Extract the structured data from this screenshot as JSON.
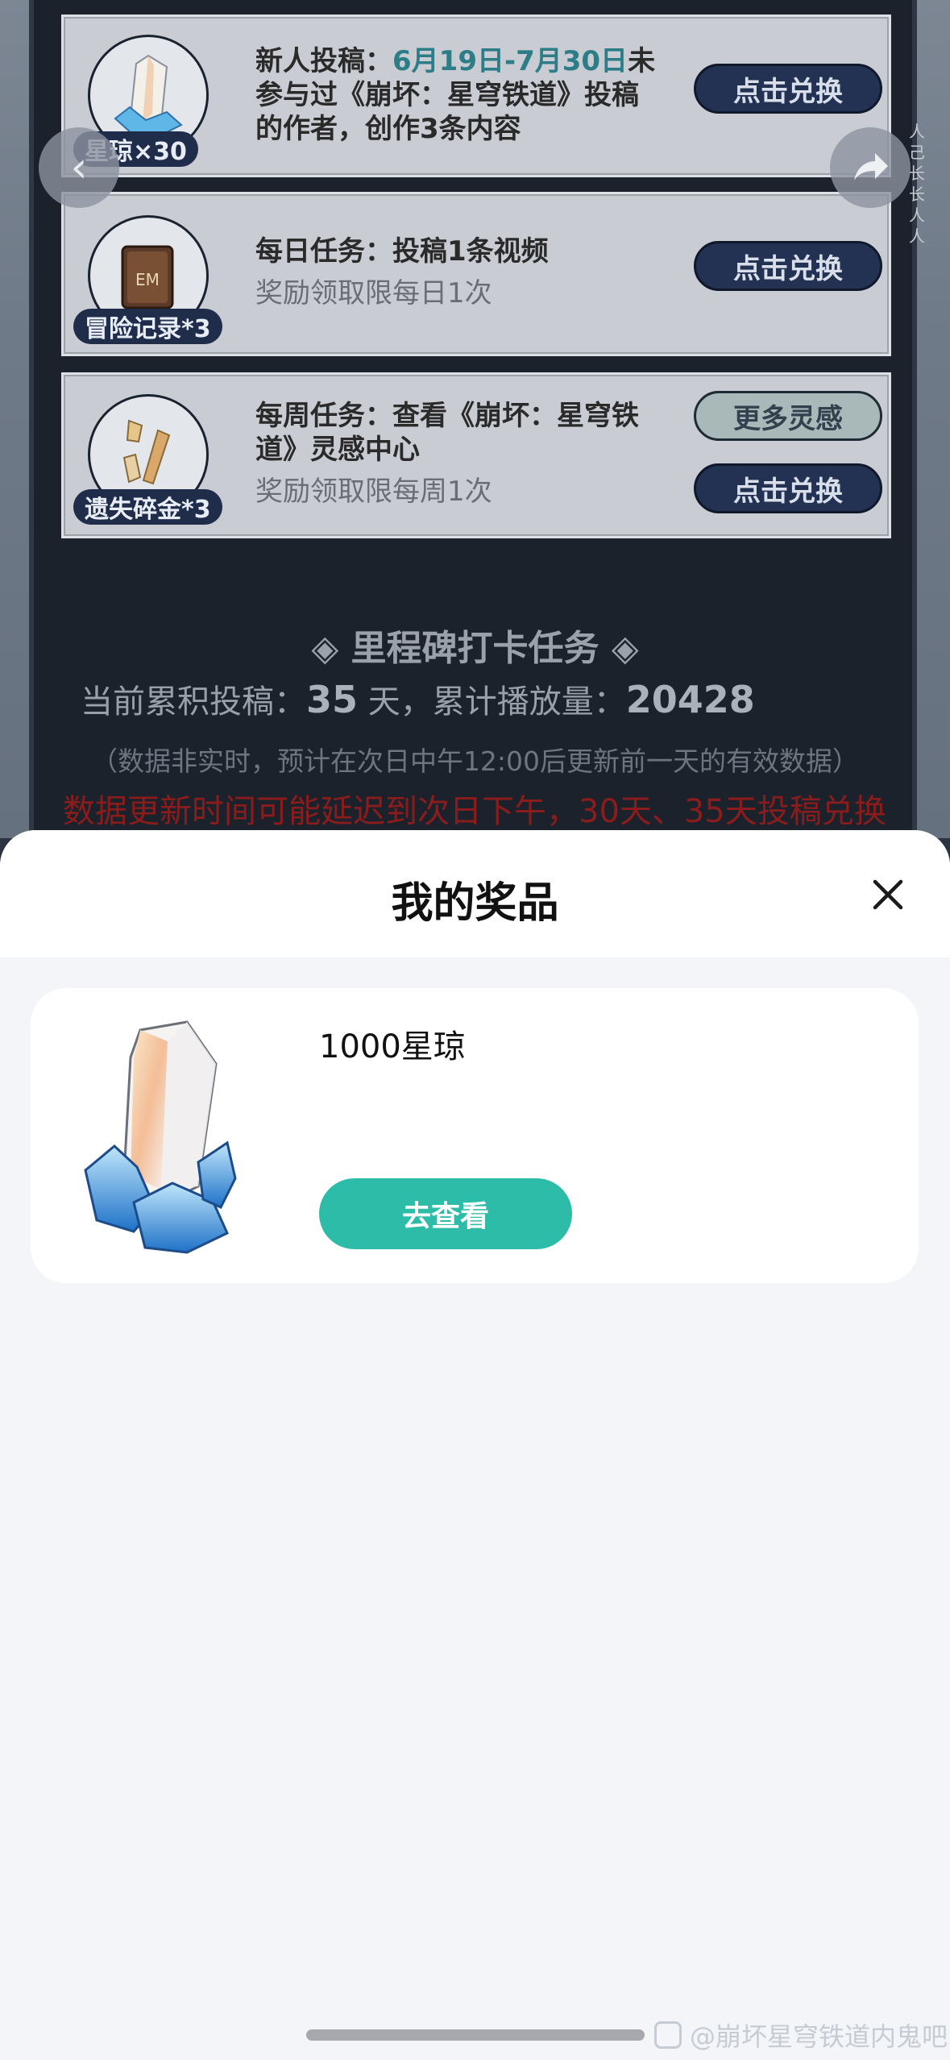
{
  "background": {
    "tasks": [
      {
        "badge": "星琼×30",
        "title_prefix": "新人投稿：",
        "title_highlight": "6月19日-7月30日",
        "title_rest": "未",
        "line2": "参与过《崩坏：星穹铁道》投稿",
        "line3": "的作者，创作3条内容",
        "button": "点击兑换"
      },
      {
        "badge": "冒险记录*3",
        "title": "每日任务：投稿1条视频",
        "sub": "奖励领取限每日1次",
        "button": "点击兑换"
      },
      {
        "badge": "遗失碎金*3",
        "title_line1": "每周任务：查看《崩坏：星穹铁",
        "title_line2": "道》灵感中心",
        "sub": "奖励领取限每周1次",
        "button_secondary": "更多灵感",
        "button": "点击兑换"
      }
    ],
    "side_text": "人己长长人人",
    "milestone_title": "◈ 里程碑打卡任务 ◈",
    "cumulative": {
      "label1": "当前累积投稿：",
      "days": "35",
      "label2": " 天，累计播放量：",
      "plays": "20428"
    },
    "note": "（数据非实时，预计在次日中午12:00后更新前一天的有效数据）",
    "warning": "数据更新时间可能延迟到次日下午，30天、35天投稿兑换"
  },
  "sheet": {
    "title": "我的奖品",
    "close_icon": "close-icon",
    "prize": {
      "name": "1000星琼",
      "button": "去查看"
    }
  },
  "watermark": "@崩坏星穹铁道内鬼吧",
  "colors": {
    "accent": "#2dbca8",
    "highlight": "#2d7d88",
    "warning": "#8a1c1c"
  }
}
